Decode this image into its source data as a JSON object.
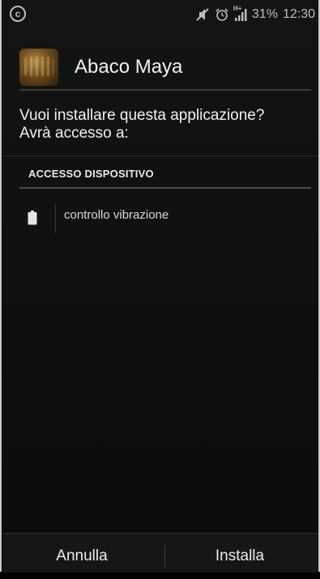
{
  "status_bar": {
    "left_icon": "copyright-circle-icon",
    "left_glyph": "c",
    "icons": [
      "mute-icon",
      "alarm-icon",
      "hplus-signal-icon"
    ],
    "signal_badge": "H+",
    "battery_percent": "31%",
    "time": "12:30"
  },
  "app": {
    "name": "Abaco Maya",
    "icon": "app-icon-abaco-maya"
  },
  "prompt": {
    "line1": "Vuoi installare questa applicazione?",
    "line2": "Avrà accesso a:"
  },
  "section": {
    "title": "ACCESSO DISPOSITIVO",
    "permissions": [
      {
        "icon": "battery-icon",
        "label": "controllo vibrazione"
      }
    ]
  },
  "buttons": {
    "cancel": "Annulla",
    "install": "Installa"
  },
  "colors": {
    "background": "#0f1112",
    "text": "#f1f1f1",
    "divider": "#3a3a3a"
  }
}
